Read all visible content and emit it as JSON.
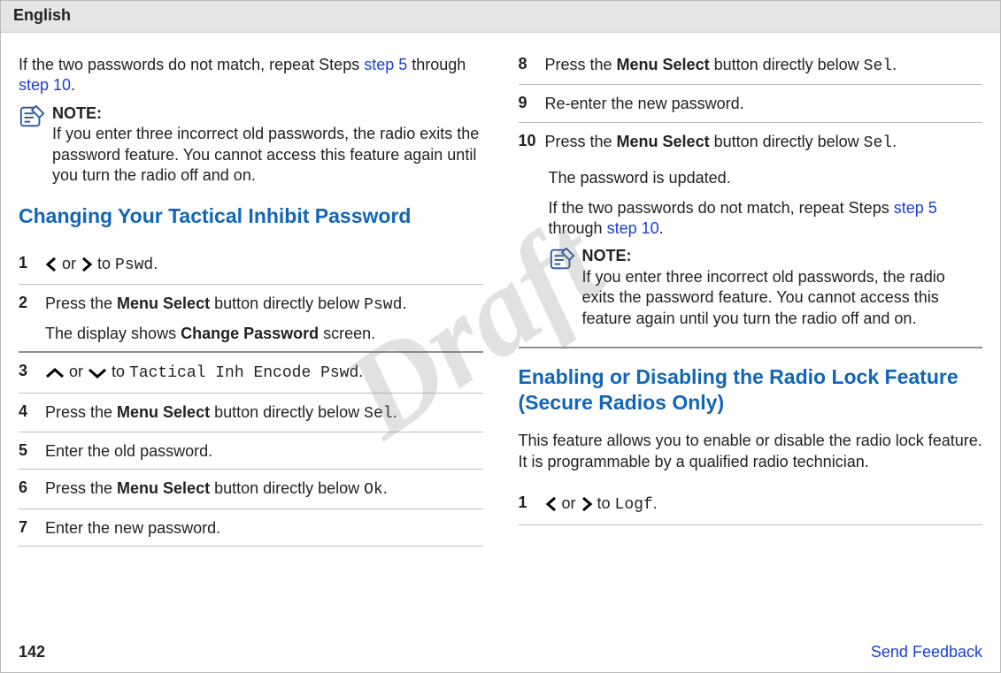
{
  "header": {
    "lang": "English"
  },
  "watermark": "Draft",
  "colA": {
    "intro_pre": "If the two passwords do not match, repeat Steps ",
    "intro_link1": "step 5",
    "intro_mid": " through ",
    "intro_link2": "step 10",
    "intro_end": ".",
    "note_label": "NOTE:",
    "note_text": "If you enter three incorrect old passwords, the radio exits the password feature. You cannot access this feature again until you turn the radio off and on.",
    "heading": "Changing Your Tactical Inhibit Password",
    "steps": {
      "s1_num": "1",
      "s1_or": " or ",
      "s1_to": " to ",
      "s1_code": "Pswd",
      "s1_end": ".",
      "s2_num": "2",
      "s2_a": "Press the ",
      "s2_b": "Menu Select",
      "s2_c": " button directly below ",
      "s2_code": "Pswd",
      "s2_d": ".",
      "s2_extra_a": "The display shows ",
      "s2_extra_b": "Change Password",
      "s2_extra_c": " screen.",
      "s3_num": "3",
      "s3_or": " or ",
      "s3_to": " to ",
      "s3_code": "Tactical Inh Encode Pswd",
      "s3_end": ".",
      "s4_num": "4",
      "s4_a": "Press the ",
      "s4_b": "Menu Select",
      "s4_c": " button directly below ",
      "s4_code": "Sel",
      "s4_d": ".",
      "s5_num": "5",
      "s5_text": "Enter the old password.",
      "s6_num": "6",
      "s6_a": "Press the ",
      "s6_b": "Menu Select",
      "s6_c": " button directly below ",
      "s6_code": "Ok",
      "s6_d": ".",
      "s7_num": "7",
      "s7_text": "Enter the new password."
    }
  },
  "colB": {
    "s8_num": "8",
    "s8_a": "Press the ",
    "s8_b": "Menu Select",
    "s8_c": " button directly below ",
    "s8_code": "Sel",
    "s8_d": ".",
    "s9_num": "9",
    "s9_text": "Re-enter the new password.",
    "s10_num": "10",
    "s10_a": "Press the ",
    "s10_b": "Menu Select",
    "s10_c": " button directly below ",
    "s10_code": "Sel",
    "s10_d": ".",
    "s10_result": "The password is updated.",
    "s10_r2_a": "If the two passwords do not match, repeat Steps ",
    "s10_r2_link1": "step 5",
    "s10_r2_mid": " through ",
    "s10_r2_link2": "step 10",
    "s10_r2_end": ".",
    "note_label": "NOTE:",
    "note_text": "If you enter three incorrect old passwords, the radio exits the password feature. You cannot access this feature again until you turn the radio off and on.",
    "heading2": "Enabling or Disabling the Radio Lock Feature (Secure Radios Only)",
    "h2_desc": "This feature allows you to enable or disable the radio lock feature. It is programmable by a qualified radio technician.",
    "sB1_num": "1",
    "sB1_or": " or ",
    "sB1_to": " to ",
    "sB1_code": "Logf",
    "sB1_end": "."
  },
  "footer": {
    "page": "142",
    "send": "Send Feedback"
  }
}
